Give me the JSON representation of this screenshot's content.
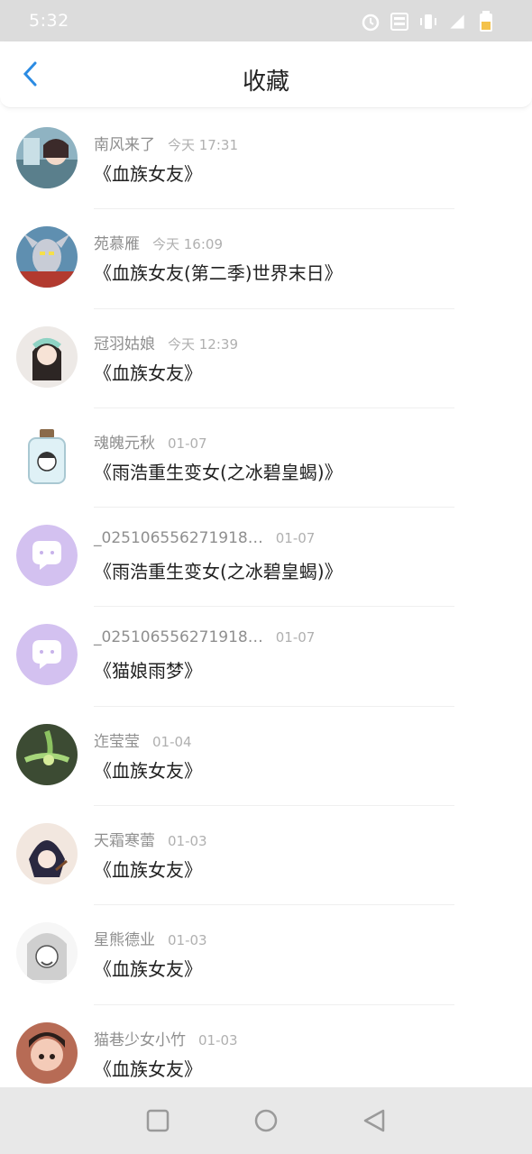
{
  "status_bar": {
    "time": "5:32"
  },
  "header": {
    "title": "收藏"
  },
  "items": [
    {
      "user": "南风来了",
      "time": "今天 17:31",
      "book": "《血族女友》",
      "avatar": "a1"
    },
    {
      "user": "苑慕雁",
      "time": "今天 16:09",
      "book": "《血族女友(第二季)世界末日》",
      "avatar": "a2"
    },
    {
      "user": "冠羽姑娘",
      "time": "今天 12:39",
      "book": "《血族女友》",
      "avatar": "a3"
    },
    {
      "user": "魂魄元秋",
      "time": "01-07",
      "book": "《雨浩重生变女(之冰碧皇蝎)》",
      "avatar": "a4"
    },
    {
      "user": "_025106556271918…",
      "time": "01-07",
      "book": "《雨浩重生变女(之冰碧皇蝎)》",
      "avatar": "default"
    },
    {
      "user": "_025106556271918…",
      "time": "01-07",
      "book": "《猫娘雨梦》",
      "avatar": "default"
    },
    {
      "user": "迮莹莹",
      "time": "01-04",
      "book": "《血族女友》",
      "avatar": "a7"
    },
    {
      "user": "天霜寒蕾",
      "time": "01-03",
      "book": "《血族女友》",
      "avatar": "a8"
    },
    {
      "user": "星熊德业",
      "time": "01-03",
      "book": "《血族女友》",
      "avatar": "a9"
    },
    {
      "user": "猫巷少女小竹",
      "time": "01-03",
      "book": "《血族女友》",
      "avatar": "a10"
    }
  ]
}
